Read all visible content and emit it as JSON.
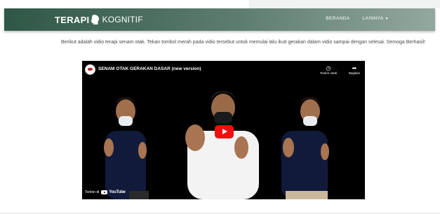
{
  "navbar": {
    "brand_part1": "TERAPI",
    "brand_part2": "KOGNITIF",
    "links": [
      "BERANDA",
      "LAINNYA"
    ]
  },
  "intro_text": "Berikut adalah vidio terapi senam otak. Tekan tombol merah pada vidio tersebut untuk memulai lalu ikuti gerakan dalam vidio sampai dengan selesai. Semoga Berhasil!",
  "video": {
    "title": "SENAM OTAK GERAKAN DASAR (new version)",
    "watch_later": "Tonton nanti",
    "share": "Bagikan",
    "watch_on": "Tonton di",
    "youtube": "YouTube"
  },
  "colors": {
    "navbar_dark": "#2f5746",
    "navbar_light": "#93a89e",
    "play_red": "#f00f0f"
  },
  "icons": [
    "head-silhouette-icon",
    "clock-icon",
    "share-arrow-icon",
    "youtube-play-icon",
    "caret-down-icon"
  ]
}
